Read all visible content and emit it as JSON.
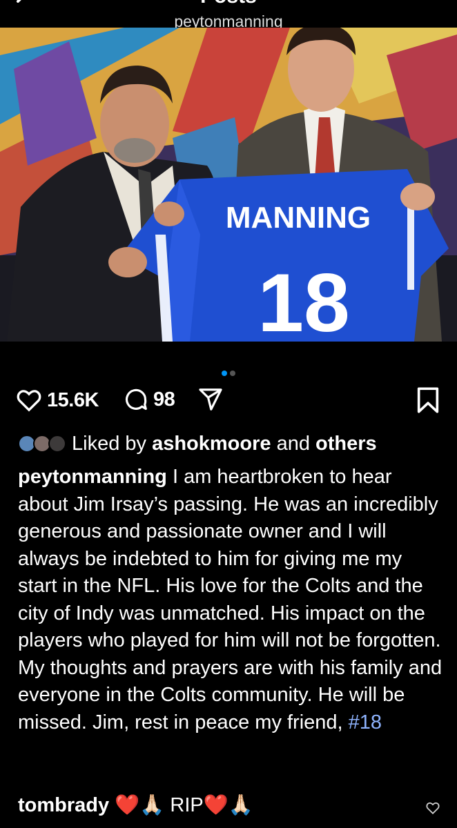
{
  "header": {
    "title": "Posts",
    "username": "peytonmanning"
  },
  "photo": {
    "jersey_name": "MANNING",
    "jersey_number": "18"
  },
  "carousel": {
    "count": 2,
    "active": 1
  },
  "actions": {
    "likes": "15.6K",
    "comments": "98",
    "icons": [
      "heart-icon",
      "comment-icon",
      "share-icon",
      "bookmark-icon"
    ]
  },
  "liked_by": {
    "prefix": "Liked by",
    "user": "ashokmoore",
    "middle": "and",
    "others": "others"
  },
  "caption": {
    "user": "peytonmanning",
    "text": "I am heartbroken to hear about Jim Irsay’s passing. He was an incredibly generous and passionate owner and I will always be indebted to him for giving me my start in the NFL. His love for the Colts and the city of Indy was unmatched. His impact on the players who played for him will not be forgotten. My thoughts and prayers are with his family and everyone in the Colts community. He will be missed. Jim, rest in peace my friend,",
    "hashtag": "#18"
  },
  "comment": {
    "user": "tombrady",
    "text": "❤️🙏🏻 RIP❤️🙏🏻"
  },
  "colors": {
    "background": "#000000",
    "accent_blue": "#0095f6",
    "hashtag": "#8fb4ff",
    "jersey_blue": "#1f4fd1"
  }
}
